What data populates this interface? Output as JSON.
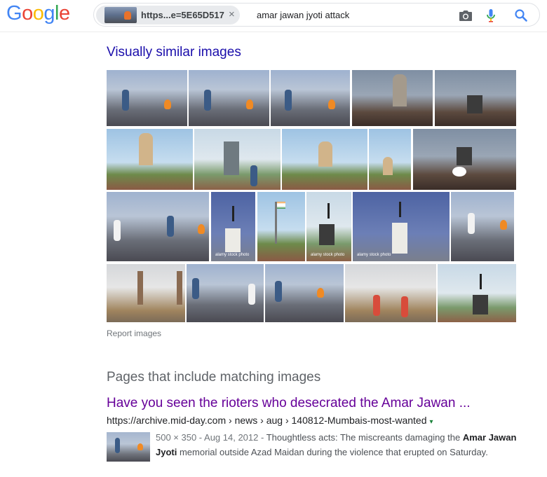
{
  "logo": {
    "letters": [
      "G",
      "o",
      "o",
      "g",
      "l",
      "e"
    ],
    "colors": [
      "#4285f4",
      "#ea4335",
      "#fbbc05",
      "#4285f4",
      "#34a853",
      "#ea4335"
    ]
  },
  "search": {
    "image_chip_label": "https...e=5E65D517",
    "image_chip_close": "×",
    "query": "amar jawan jyoti attack",
    "icons": [
      "camera-icon",
      "mic-icon",
      "search-icon"
    ]
  },
  "similar": {
    "title": "Visually similar images",
    "report_label": "Report images",
    "watermarks": {
      "alamy_a": "alamy stock photo",
      "alamy_b": "alamy stock photo",
      "alamy_c": "alamy stock photo"
    }
  },
  "pages": {
    "title": "Pages that include matching images",
    "result": {
      "title": "Have you seen the rioters who desecrated the Amar Jawan ...",
      "url": "https://archive.mid-day.com › news › aug › 140812-Mumbais-most-wanted",
      "url_caret": "▾",
      "meta": "500 × 350 - Aug 14, 2012 - ",
      "snippet_a": "Thoughtless acts: The miscreants damaging the ",
      "snippet_bold": "Amar Jawan Jyoti",
      "snippet_b": " memorial outside Azad Maidan during the violence that erupted on Saturday."
    }
  }
}
